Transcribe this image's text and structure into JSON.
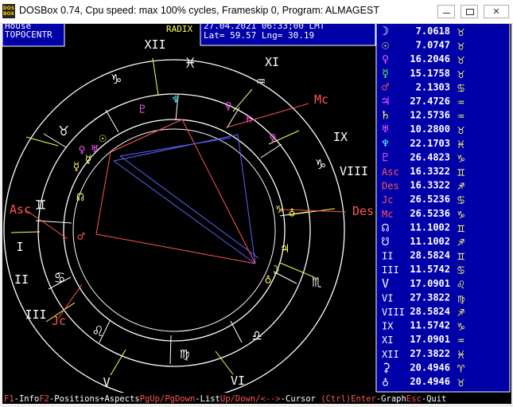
{
  "window": {
    "title": "DOSBox 0.74, Cpu speed: max 100% cycles, Frameskip  0, Program: ALMAGEST",
    "icon_name": "dosbox-icon",
    "close_glyph": "✕"
  },
  "house_box": {
    "line1": "House",
    "line2": "TOPOCENTR"
  },
  "radix_label": "RADIX",
  "header_info": {
    "datetime": "27.04.2021 06:33;00 LMT",
    "coords": "Lat= 59.57 Lng= 30.19"
  },
  "wheel_markers": {
    "house_numerals": [
      "I",
      "II",
      "III",
      "IV",
      "V",
      "VI",
      "VII",
      "VIII",
      "IX",
      "X",
      "XI",
      "XII"
    ],
    "axes": [
      "Asc",
      "Des",
      "Mc",
      "Jc"
    ]
  },
  "positions": [
    {
      "name": "moon-row",
      "value": "7.0618",
      "planet": "☽",
      "sign": "♉"
    },
    {
      "name": "sun-row",
      "value": "7.0747",
      "planet": "☉",
      "sign": "♉"
    },
    {
      "name": "venus-row",
      "value": "16.2046",
      "planet": "♀",
      "sign": "♉"
    },
    {
      "name": "mercury-row",
      "value": "15.1758",
      "planet": "☿",
      "sign": "♉"
    },
    {
      "name": "mars-row",
      "value": "2.1303",
      "planet": "♂",
      "sign": "♋"
    },
    {
      "name": "jupiter-row",
      "value": "27.4726",
      "planet": "♃",
      "sign": "♒"
    },
    {
      "name": "saturn-row",
      "value": "12.5736",
      "planet": "♄",
      "sign": "♒"
    },
    {
      "name": "uranus-row",
      "value": "10.2800",
      "planet": "♅",
      "sign": "♉"
    },
    {
      "name": "neptune-row",
      "value": "22.1703",
      "planet": "♆",
      "sign": "♓"
    },
    {
      "name": "pluto-row",
      "value": "26.4823",
      "planet": "♇",
      "sign": "♑"
    },
    {
      "name": "asc-row",
      "value": "16.3322",
      "planet": "Asc",
      "sign": "♊"
    },
    {
      "name": "des-row",
      "value": "16.3322",
      "planet": "Des",
      "sign": "♐"
    },
    {
      "name": "jc-row",
      "value": "26.5236",
      "planet": "Jc",
      "sign": "♋"
    },
    {
      "name": "mc-row",
      "value": "26.5236",
      "planet": "Mc",
      "sign": "♑"
    },
    {
      "name": "north-node-row",
      "value": "11.1002",
      "planet": "☊",
      "sign": "♊"
    },
    {
      "name": "south-node-row",
      "value": "11.1002",
      "planet": "☋",
      "sign": "♐"
    },
    {
      "name": "house-2-row",
      "value": "28.5824",
      "planet": "II",
      "sign": "♊"
    },
    {
      "name": "house-3-row",
      "value": "11.5742",
      "planet": "III",
      "sign": "♋"
    },
    {
      "name": "house-5-row",
      "value": "17.0901",
      "planet": "V",
      "sign": "♌"
    },
    {
      "name": "house-6-row",
      "value": "27.3822",
      "planet": "VI",
      "sign": "♍"
    },
    {
      "name": "house-8-row",
      "value": "28.5824",
      "planet": "VIII",
      "sign": "♐"
    },
    {
      "name": "house-9-row",
      "value": "11.5742",
      "planet": "IX",
      "sign": "♑"
    },
    {
      "name": "house-11-row",
      "value": "17.0901",
      "planet": "XI",
      "sign": "♒"
    },
    {
      "name": "house-12-row",
      "value": "27.3822",
      "planet": "XII",
      "sign": "♓"
    },
    {
      "name": "ceres-row",
      "value": "20.4946",
      "planet": "⚳",
      "sign": "♈"
    },
    {
      "name": "earth-row",
      "value": "20.4946",
      "planet": "♁",
      "sign": "♉"
    }
  ],
  "status_bar": [
    {
      "name": "f1-info",
      "key": "F1",
      "label": "-Info"
    },
    {
      "name": "f2-positions",
      "key": "F2",
      "label": "-Positions+Aspects"
    },
    {
      "name": "pgup-pgdown-list",
      "key": "PgUp/PgDown",
      "label": "-List"
    },
    {
      "name": "arrows-cursor",
      "key": "Up/Down/<-->",
      "label": "-Cursor "
    },
    {
      "name": "ctrl-enter-graph",
      "key": "(Ctrl)Enter",
      "label": "-Graph"
    },
    {
      "name": "esc-quit",
      "key": "Esc",
      "label": "-Quit"
    }
  ],
  "colors": {
    "panel_bg": "#0000a8",
    "text": "#ffffff",
    "header_bg": "#0000a8",
    "key_red": "#ff5555",
    "cyan": "#55ffff",
    "yellow": "#ffff55",
    "magenta": "#ff55ff",
    "green": "#55ff55",
    "red": "#ff5555"
  }
}
